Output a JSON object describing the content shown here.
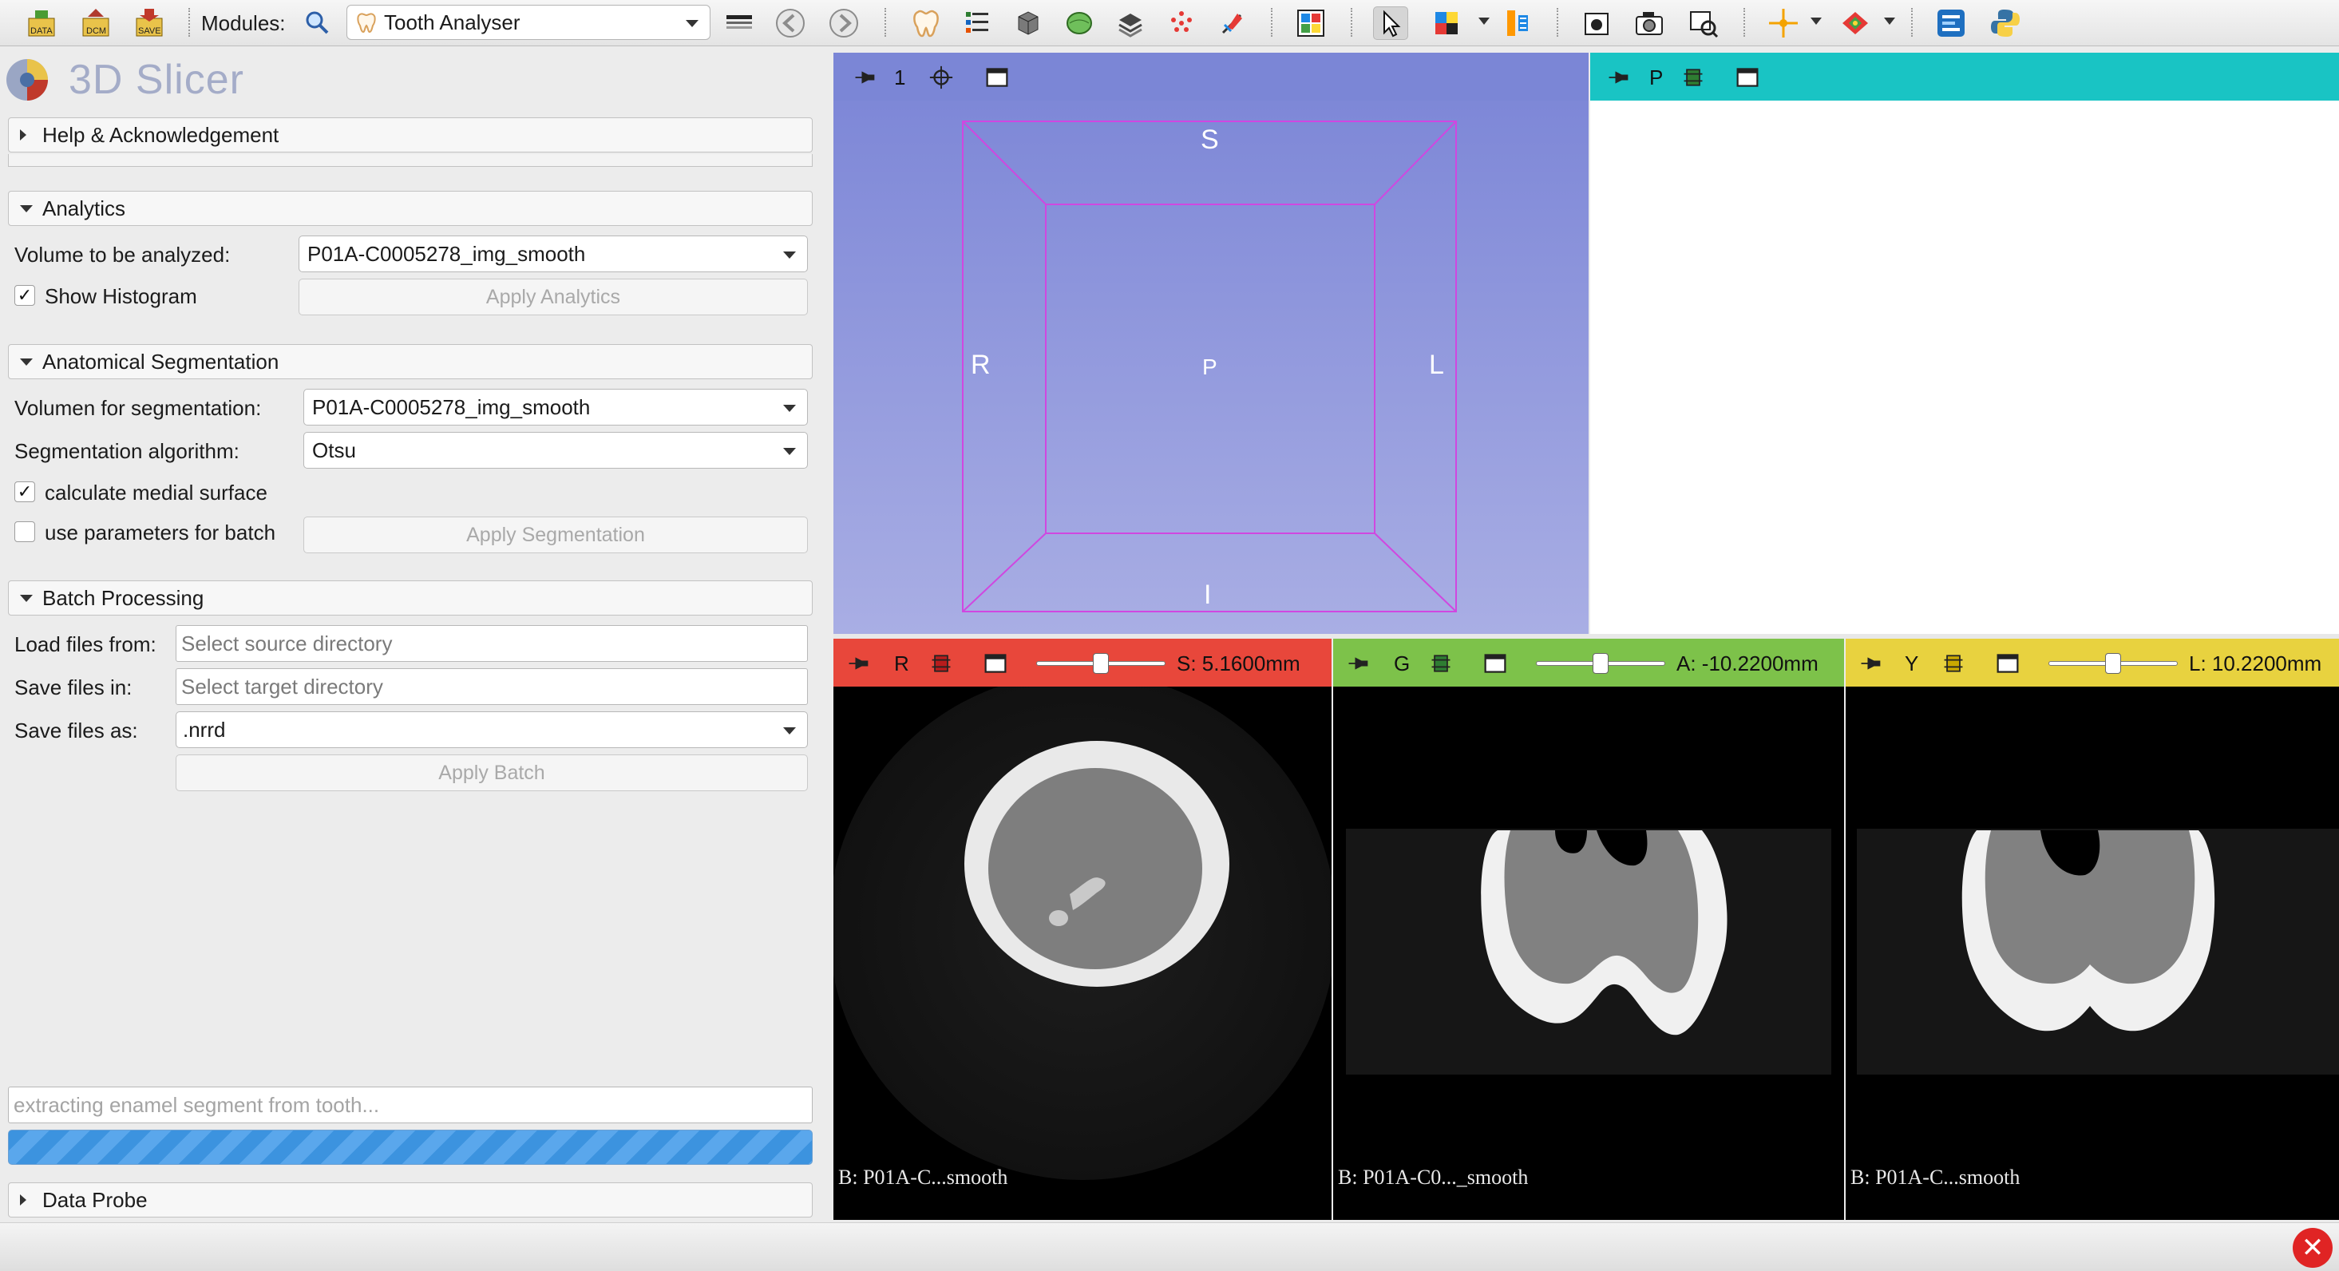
{
  "toolbar": {
    "modules_label": "Modules:",
    "current_module": "Tooth Analyser",
    "icons": [
      "data-icon",
      "dcm-icon",
      "save-icon",
      "search-icon",
      "layout-icon",
      "back-icon",
      "forward-icon",
      "tooth-icon",
      "models-icon",
      "volume-rendering-icon",
      "segment-icon",
      "transforms-icon",
      "markups-icon",
      "editor-icon",
      "layout-grid-icon",
      "pointer-icon",
      "crosshair-icon",
      "mouse-mode-icon",
      "capture-icon",
      "camera-icon",
      "screen-capture-icon",
      "place-icon",
      "fiducial-icon",
      "extension-icon",
      "python-icon"
    ]
  },
  "app": {
    "title": "3D Slicer"
  },
  "sections": {
    "help": "Help & Acknowledgement",
    "analytics": {
      "title": "Analytics",
      "volume_label": "Volume to be analyzed:",
      "volume_value": "P01A-C0005278_img_smooth",
      "show_histogram_label": "Show Histogram",
      "show_histogram_checked": "✓",
      "apply_label": "Apply Analytics"
    },
    "segmentation": {
      "title": "Anatomical Segmentation",
      "volume_label": "Volumen for segmentation:",
      "volume_value": "P01A-C0005278_img_smooth",
      "algorithm_label": "Segmentation algorithm:",
      "algorithm_value": "Otsu",
      "medial_label": "calculate medial surface",
      "medial_checked": "✓",
      "batch_params_label": "use parameters for batch",
      "apply_label": "Apply Segmentation"
    },
    "batch": {
      "title": "Batch Processing",
      "load_label": "Load files from:",
      "load_placeholder": "Select source directory",
      "save_label": "Save files in:",
      "save_placeholder": "Select target directory",
      "save_as_label": "Save files as:",
      "save_as_value": ".nrrd",
      "apply_label": "Apply Batch"
    },
    "status": {
      "message": "extracting enamel segment from tooth...",
      "progress": 1.0
    },
    "data_probe": "Data Probe"
  },
  "views": {
    "three_d": {
      "label": "1",
      "color": "#7b86d6",
      "orient_s": "S",
      "orient_i": "I",
      "orient_r": "R",
      "orient_l": "L",
      "orient_p": "P"
    },
    "plot": {
      "label": "P",
      "color": "#19c4c4"
    },
    "red": {
      "label": "R",
      "color": "#e8473b",
      "offset": "S: 5.1600mm",
      "offset_fraction": 0.5,
      "background": "B: P01A-C...smooth"
    },
    "green": {
      "label": "G",
      "color": "#7dc24a",
      "offset": "A: -10.2200mm",
      "offset_fraction": 0.5,
      "background": "B: P01A-C0..._smooth"
    },
    "yellow": {
      "label": "Y",
      "color": "#e8d23f",
      "offset": "L: 10.2200mm",
      "offset_fraction": 0.5,
      "background": "B: P01A-C...smooth"
    }
  }
}
